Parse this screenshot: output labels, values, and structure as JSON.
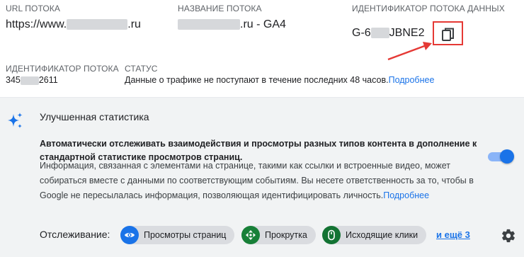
{
  "stream": {
    "url_label": "URL ПОТОКА",
    "url_prefix": "https://www.",
    "url_suffix": ".ru",
    "name_label": "НАЗВАНИЕ ПОТОКА",
    "name_suffix": ".ru - GA4",
    "data_id_label": "ИДЕНТИФИКАТОР ПОТОКА ДАННЫХ",
    "data_id_prefix": "G-6",
    "data_id_suffix": "JBNE2",
    "stream_id_label": "ИДЕНТИФИКАТОР ПОТОКА",
    "stream_id_prefix": "345",
    "stream_id_suffix": "2611",
    "status_label": "СТАТУС",
    "status_text": "Данные о трафике не поступают в течение последних 48 часов.",
    "status_link": "Подробнее"
  },
  "enhanced": {
    "title": "Улучшенная статистика",
    "desc_bold": "Автоматически отслеживать взаимодействия и просмотры разных типов контента в дополнение к стандартной статистике просмотров страниц.",
    "desc": "Информация, связанная с элементами на странице, такими как ссылки и встроенные видео, может собираться вместе с данными по соответствующим событиям. Вы несете ответственность за то, чтобы в Google не пересылалась информация, позволяющая идентифицировать личность.",
    "desc_link": "Подробнее",
    "toggle_on": true,
    "tracking_label": "Отслеживание:",
    "chips": [
      {
        "label": "Просмотры страниц",
        "icon": "eye-icon",
        "color": "#1a73e8"
      },
      {
        "label": "Прокрутка",
        "icon": "scroll-arrows-icon",
        "color": "#188038"
      },
      {
        "label": "Исходящие клики",
        "icon": "mouse-icon",
        "color": "#137333"
      }
    ],
    "more": "и ещё 3"
  },
  "colors": {
    "accent": "#1a73e8",
    "highlight": "#e53935",
    "section_bg": "#f1f3f4"
  }
}
